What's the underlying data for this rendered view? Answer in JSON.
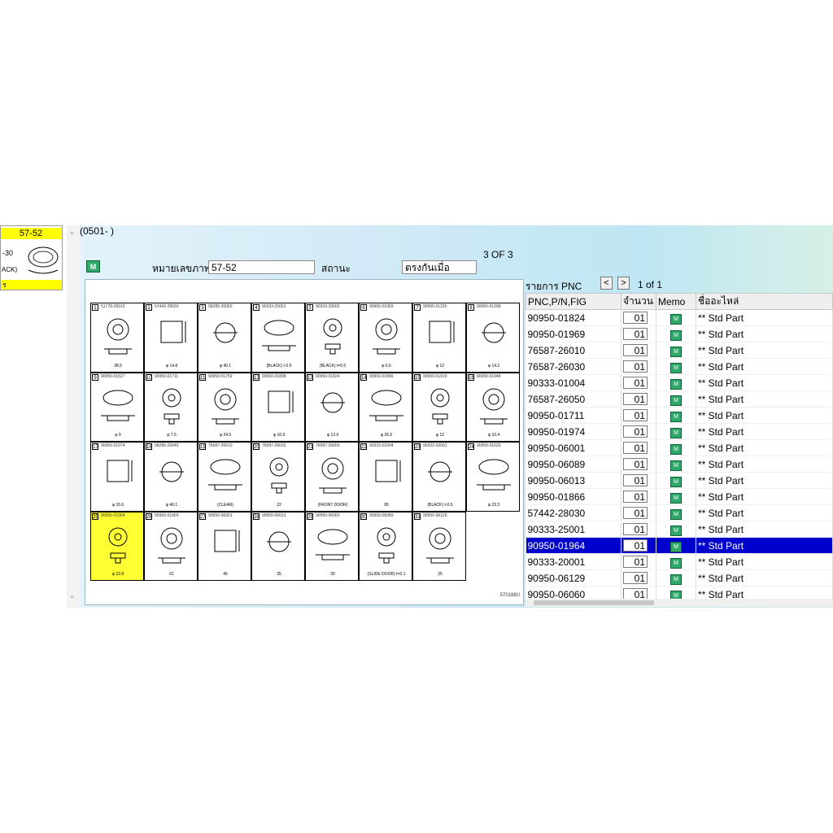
{
  "thumbnail": {
    "title": "57-52",
    "label_fragment": "-30",
    "label_fragment2": "ACK)",
    "bottom_text": "ร"
  },
  "header": {
    "code": "(0501-    )",
    "page_of": "3 OF  3"
  },
  "fields": {
    "image_no_label": "หมายเลขภาพ",
    "image_no_value": "57-52",
    "status_label": "สถานะ",
    "status_value": "ตรงกันเมื่อ"
  },
  "logo_text": "M",
  "diagram": {
    "fig_code": "570188U",
    "cells": [
      {
        "n": "1",
        "pn": "51778-26010",
        "cap": "38.5"
      },
      {
        "n": "2",
        "pn": "57442-28030",
        "cap": "φ 14.8"
      },
      {
        "n": "3",
        "pn": "58285-26050",
        "cap": "φ 40.1"
      },
      {
        "n": "4",
        "pn": "90333-25001",
        "cap": "(BLACK) t-0.5"
      },
      {
        "n": "5",
        "pn": "90333-20002",
        "cap": "(BLACK) t=0.5"
      },
      {
        "n": "6",
        "pn": "90950-01069",
        "cap": "φ 6.5"
      },
      {
        "n": "7",
        "pn": "90950-01126",
        "cap": "φ 12"
      },
      {
        "n": "8",
        "pn": "90950-01398",
        "cap": "φ 14.2"
      },
      {
        "n": "9",
        "pn": "90950-01527",
        "cap": "φ 9"
      },
      {
        "n": "10",
        "pn": "90950-01711",
        "cap": "φ 7.5"
      },
      {
        "n": "11",
        "pn": "90950-01759",
        "cap": "φ 24.5"
      },
      {
        "n": "12",
        "pn": "90950-01808",
        "cap": "φ 16.9"
      },
      {
        "n": "13",
        "pn": "90950-01824",
        "cap": "φ 13.9"
      },
      {
        "n": "14",
        "pn": "90950-01866",
        "cap": "φ 26.5"
      },
      {
        "n": "15",
        "pn": "90950-01919",
        "cap": "φ 12"
      },
      {
        "n": "16",
        "pn": "90950-01948",
        "cap": "φ 10.4"
      },
      {
        "n": "17",
        "pn": "90950-01974",
        "cap": "φ 15.6"
      },
      {
        "n": "18",
        "pn": "58285-26040",
        "cap": "φ 40.1"
      },
      {
        "n": "19",
        "pn": "76587-26010",
        "cap": "(CLEAR)"
      },
      {
        "n": "20",
        "pn": "76587-26030",
        "cap": "22"
      },
      {
        "n": "21",
        "pn": "76587-26050",
        "cap": "(FRONT DOOR)"
      },
      {
        "n": "22",
        "pn": "90333-01004",
        "cap": "95"
      },
      {
        "n": "23",
        "pn": "90333-20001",
        "cap": "(BLACK) t-0.5"
      },
      {
        "n": "24",
        "pn": "90950-01620",
        "cap": "φ 23.3"
      },
      {
        "n": "25",
        "pn": "90950-01964",
        "cap": "φ 22.8"
      },
      {
        "n": "26",
        "pn": "90950-01969",
        "cap": "61"
      },
      {
        "n": "27",
        "pn": "90950-06001",
        "cap": "45"
      },
      {
        "n": "28",
        "pn": "90950-06013",
        "cap": "35"
      },
      {
        "n": "29",
        "pn": "90950-06060",
        "cap": "30"
      },
      {
        "n": "30",
        "pn": "90950-06089",
        "cap": "(SLIDE DOOR) t=0.1"
      },
      {
        "n": "31",
        "pn": "90950-06129",
        "cap": "25"
      }
    ]
  },
  "parts": {
    "header_label": "รายการ PNC",
    "prev": "<",
    "next": ">",
    "page_count": "1 of 1",
    "columns": [
      "PNC,P/N,FIG",
      "จำนวน",
      "Memo",
      "ชื่ออะไหล่"
    ],
    "rows": [
      {
        "pn": "90950-01824",
        "qty": "01",
        "name": "** Std Part"
      },
      {
        "pn": "90950-01969",
        "qty": "01",
        "name": "** Std Part"
      },
      {
        "pn": "76587-26010",
        "qty": "01",
        "name": "** Std Part"
      },
      {
        "pn": "76587-26030",
        "qty": "01",
        "name": "** Std Part"
      },
      {
        "pn": "90333-01004",
        "qty": "01",
        "name": "** Std Part"
      },
      {
        "pn": "76587-26050",
        "qty": "01",
        "name": "** Std Part"
      },
      {
        "pn": "90950-01711",
        "qty": "01",
        "name": "** Std Part"
      },
      {
        "pn": "90950-01974",
        "qty": "01",
        "name": "** Std Part"
      },
      {
        "pn": "90950-06001",
        "qty": "01",
        "name": "** Std Part"
      },
      {
        "pn": "90950-06089",
        "qty": "01",
        "name": "** Std Part"
      },
      {
        "pn": "90950-06013",
        "qty": "01",
        "name": "** Std Part"
      },
      {
        "pn": "90950-01866",
        "qty": "01",
        "name": "** Std Part"
      },
      {
        "pn": "57442-28030",
        "qty": "01",
        "name": "** Std Part"
      },
      {
        "pn": "90333-25001",
        "qty": "01",
        "name": "** Std Part"
      },
      {
        "pn": "90950-01964",
        "qty": "01",
        "name": "** Std Part",
        "selected": true
      },
      {
        "pn": "90333-20001",
        "qty": "01",
        "name": "** Std Part"
      },
      {
        "pn": "90950-06129",
        "qty": "01",
        "name": "** Std Part"
      },
      {
        "pn": "90950-06060",
        "qty": "01",
        "name": "** Std Part"
      }
    ]
  },
  "colors": {
    "highlight": "#ffff33",
    "selection": "#0000cc",
    "memo_icon": "#2fa86a"
  }
}
